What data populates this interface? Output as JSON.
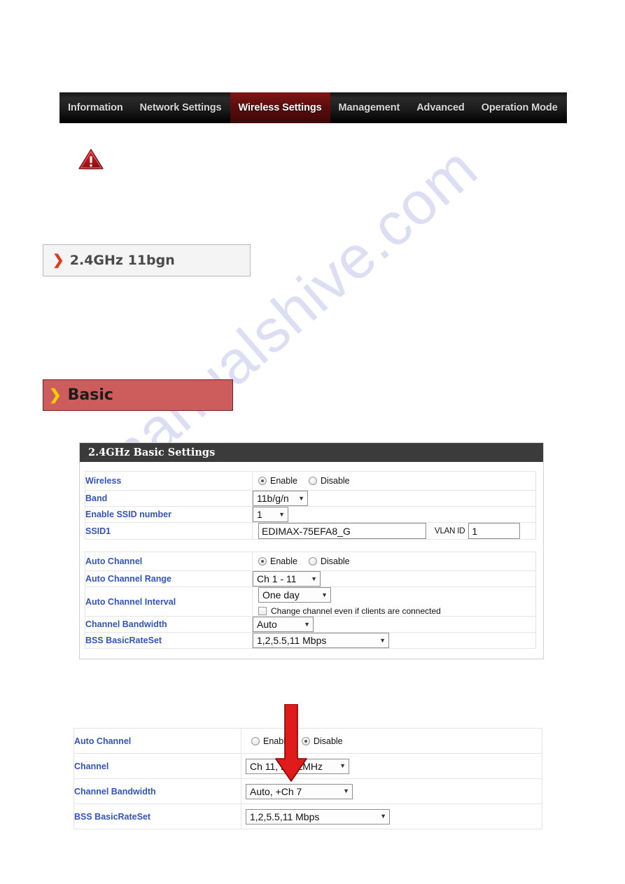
{
  "nav": {
    "items": [
      {
        "label": "Information",
        "active": false
      },
      {
        "label": "Network Settings",
        "active": false
      },
      {
        "label": "Wireless Settings",
        "active": true
      },
      {
        "label": "Management",
        "active": false
      },
      {
        "label": "Advanced",
        "active": false
      },
      {
        "label": "Operation Mode",
        "active": false
      }
    ]
  },
  "watermark": {
    "text": "manualshive.com"
  },
  "headers": {
    "band": {
      "chevron": "❯",
      "label": "2.4GHz 11bgn"
    },
    "basic": {
      "chevron": "❯",
      "label": "Basic"
    }
  },
  "panel": {
    "title": "2.4GHz Basic Settings",
    "group1": [
      {
        "label": "Wireless",
        "type": "radio",
        "options": [
          {
            "label": "Enable",
            "selected": true
          },
          {
            "label": "Disable",
            "selected": false
          }
        ]
      },
      {
        "label": "Band",
        "type": "select",
        "value": "11b/g/n",
        "caret": "▼"
      },
      {
        "label": "Enable SSID number",
        "type": "select",
        "value": "1",
        "caret": "▼"
      },
      {
        "label": "SSID1",
        "type": "text-vlan",
        "value": "EDIMAX-75EFA8_G",
        "vlan_label": "VLAN ID",
        "vlan_value": "1"
      }
    ],
    "group2": [
      {
        "label": "Auto Channel",
        "type": "radio",
        "options": [
          {
            "label": "Enable",
            "selected": true
          },
          {
            "label": "Disable",
            "selected": false
          }
        ]
      },
      {
        "label": "Auto Channel Range",
        "type": "select",
        "value": "Ch 1 - 11",
        "caret": "▼"
      },
      {
        "label": "Auto Channel Interval",
        "type": "select-check",
        "value": "One day",
        "caret": "▼",
        "checkbox_label": "Change channel even if clients are connected",
        "checked": false
      },
      {
        "label": "Channel Bandwidth",
        "type": "select",
        "value": "Auto",
        "caret": "▼"
      },
      {
        "label": "BSS BasicRateSet",
        "type": "select",
        "value": "1,2,5.5,11 Mbps",
        "caret": "▼"
      }
    ]
  },
  "panel2": {
    "rows": [
      {
        "label": "Auto Channel",
        "type": "radio",
        "options": [
          {
            "label": "Enable",
            "selected": false
          },
          {
            "label": "Disable",
            "selected": true
          }
        ]
      },
      {
        "label": "Channel",
        "type": "select",
        "value": "Ch 11, 2462MHz",
        "caret": "▼"
      },
      {
        "label": "Channel Bandwidth",
        "type": "select",
        "value": "Auto, +Ch 7",
        "caret": "▼"
      },
      {
        "label": "BSS BasicRateSet",
        "type": "select",
        "value": "1,2,5.5,11 Mbps",
        "caret": "▼"
      }
    ]
  },
  "colors": {
    "nav_active": "#5d0d0d",
    "label_blue": "#3355bb",
    "basic_header_bg": "#cd5c5c",
    "chevron_yellow": "#f5d000",
    "chevron_red": "#d9401f",
    "arrow_red": "#e01b1b",
    "panel_title_bg": "#3b3b3b"
  },
  "icons": {
    "warning": "warning-triangle-icon",
    "arrow": "red-down-arrow-icon"
  }
}
